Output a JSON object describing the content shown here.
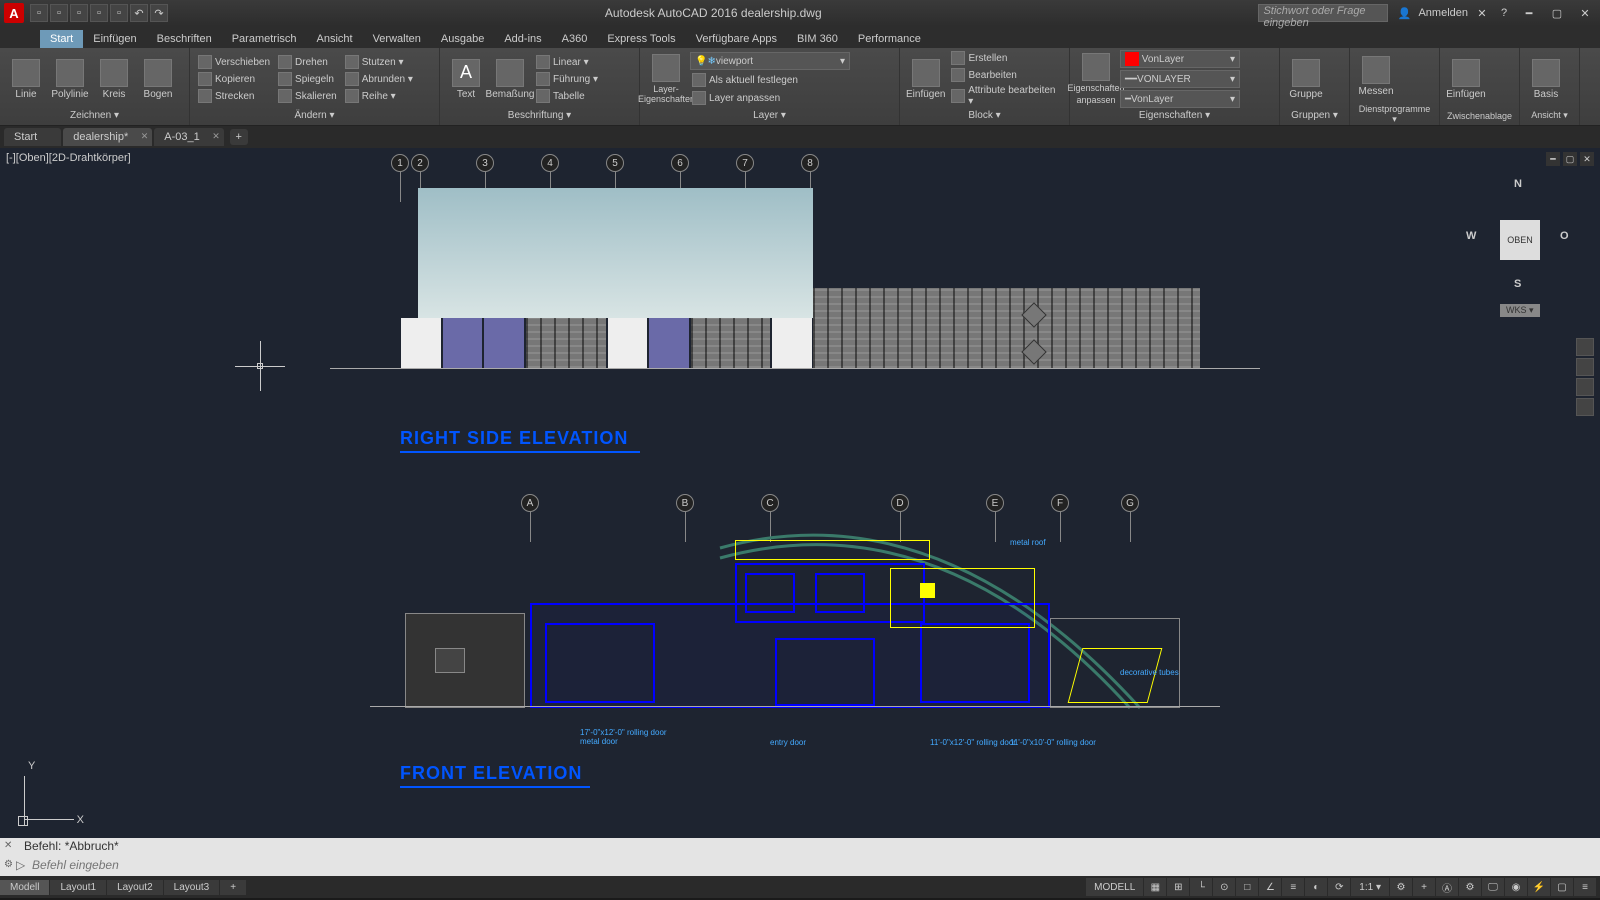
{
  "title": "Autodesk AutoCAD 2016    dealership.dwg",
  "search_placeholder": "Stichwort oder Frage eingeben",
  "user": "Anmelden",
  "ribbon_tabs": [
    "Start",
    "Einfügen",
    "Beschriften",
    "Parametrisch",
    "Ansicht",
    "Verwalten",
    "Ausgabe",
    "Add-ins",
    "A360",
    "Express Tools",
    "Verfügbare Apps",
    "BIM 360",
    "Performance"
  ],
  "ribbon": {
    "zeichnen": {
      "label": "Zeichnen ▾",
      "linie": "Linie",
      "polylinie": "Polylinie",
      "kreis": "Kreis",
      "bogen": "Bogen"
    },
    "aendern": {
      "label": "Ändern ▾",
      "verschieben": "Verschieben",
      "kopieren": "Kopieren",
      "strecken": "Strecken",
      "drehen": "Drehen",
      "spiegeln": "Spiegeln",
      "skalieren": "Skalieren",
      "stutzen": "Stutzen ▾",
      "abrunden": "Abrunden ▾",
      "reihe": "Reihe ▾"
    },
    "beschriftung": {
      "label": "Beschriftung ▾",
      "text": "Text",
      "bemassung": "Bemaßung",
      "linear": "Linear ▾",
      "fuehrung": "Führung ▾",
      "tabelle": "Tabelle"
    },
    "layer": {
      "label": "Layer ▾",
      "eigenschaften": "Layer-Eigenschaften",
      "dropdown": "viewport",
      "aktuell": "Als aktuell festlegen",
      "anpassen": "Layer anpassen"
    },
    "block": {
      "label": "Block ▾",
      "einfuegen": "Einfügen",
      "erstellen": "Erstellen",
      "bearbeiten": "Bearbeiten",
      "attribute": "Attribute bearbeiten ▾"
    },
    "eigenschaften": {
      "label": "Eigenschaften ▾",
      "main": "Eigenschaften",
      "anpassen": "anpassen",
      "color": "VonLayer",
      "ltype": "VONLAYER",
      "lweight": "VonLayer"
    },
    "gruppen": {
      "label": "Gruppen ▾",
      "gruppe": "Gruppe"
    },
    "dienst": {
      "label": "Dienstprogramme ▾",
      "messen": "Messen"
    },
    "zwischen": {
      "label": "Zwischenablage",
      "einfuegen": "Einfügen"
    },
    "ansicht": {
      "label": "Ansicht ▾",
      "basis": "Basis"
    }
  },
  "file_tabs": {
    "start": "Start",
    "dealership": "dealership*",
    "a03": "A-03_1"
  },
  "viewport_label": "[-][Oben][2D-Drahtkörper]",
  "viewcube": {
    "n": "N",
    "s": "S",
    "e": "O",
    "w": "W",
    "face": "OBEN",
    "wks": "WKS ▾"
  },
  "grid_top": [
    "1",
    "2",
    "3",
    "4",
    "5",
    "6",
    "7",
    "8"
  ],
  "grid_bottom": [
    "A",
    "B",
    "C",
    "D",
    "E",
    "F",
    "G"
  ],
  "titles": {
    "right": "RIGHT SIDE ELEVATION",
    "front": "FRONT ELEVATION"
  },
  "annotations": {
    "metal_roof": "metal roof",
    "entry": "entry door",
    "rolling1": "11'-0\"x12'-0\" rolling door",
    "rolling2": "11'-0\"x10'-0\" rolling door",
    "rolling3": "17'-0\"x12'-0\" rolling door metal door",
    "deco": "decorative tubes"
  },
  "ucs": {
    "y": "Y",
    "x": "X"
  },
  "cmd": {
    "history": "Befehl: *Abbruch*",
    "placeholder": "Befehl eingeben"
  },
  "bottom_tabs": [
    "Modell",
    "Layout1",
    "Layout2",
    "Layout3"
  ],
  "status": {
    "modell": "MODELL",
    "scale": "1:1 ▾"
  }
}
